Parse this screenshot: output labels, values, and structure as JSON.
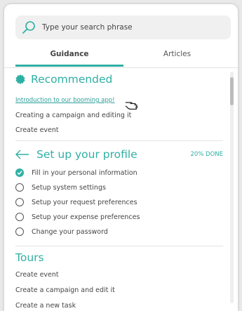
{
  "search": {
    "placeholder": "Type your search phrase",
    "value": ""
  },
  "tabs": [
    {
      "label": "Guidance",
      "active": true
    },
    {
      "label": "Articles",
      "active": false
    }
  ],
  "recommended": {
    "title": "Recommended",
    "items": [
      {
        "label": "Introduction to our booming app!",
        "style": "link"
      },
      {
        "label": "Creating a campaign and editing it"
      },
      {
        "label": "Create event"
      }
    ]
  },
  "profile": {
    "title": "Set up your profile",
    "progress_label": "20% DONE",
    "progress_fraction": 0.2,
    "items": [
      {
        "label": "Fill in your personal information",
        "done": true
      },
      {
        "label": "Setup system settings",
        "done": false
      },
      {
        "label": "Setup your request preferences",
        "done": false
      },
      {
        "label": "Setup your expense preferences",
        "done": false
      },
      {
        "label": "Change your password",
        "done": false
      }
    ]
  },
  "tours": {
    "title": "Tours",
    "items": [
      {
        "label": "Create event"
      },
      {
        "label": "Create a campaign and edit it"
      },
      {
        "label": "Create a new task"
      }
    ]
  },
  "icons": {
    "search": "search-icon",
    "recommended": "badge-icon",
    "back": "back-arrow-icon",
    "check": "check-circle-icon",
    "cursor": "hand-pointer-icon"
  },
  "colors": {
    "accent": "#2fb0a4"
  }
}
